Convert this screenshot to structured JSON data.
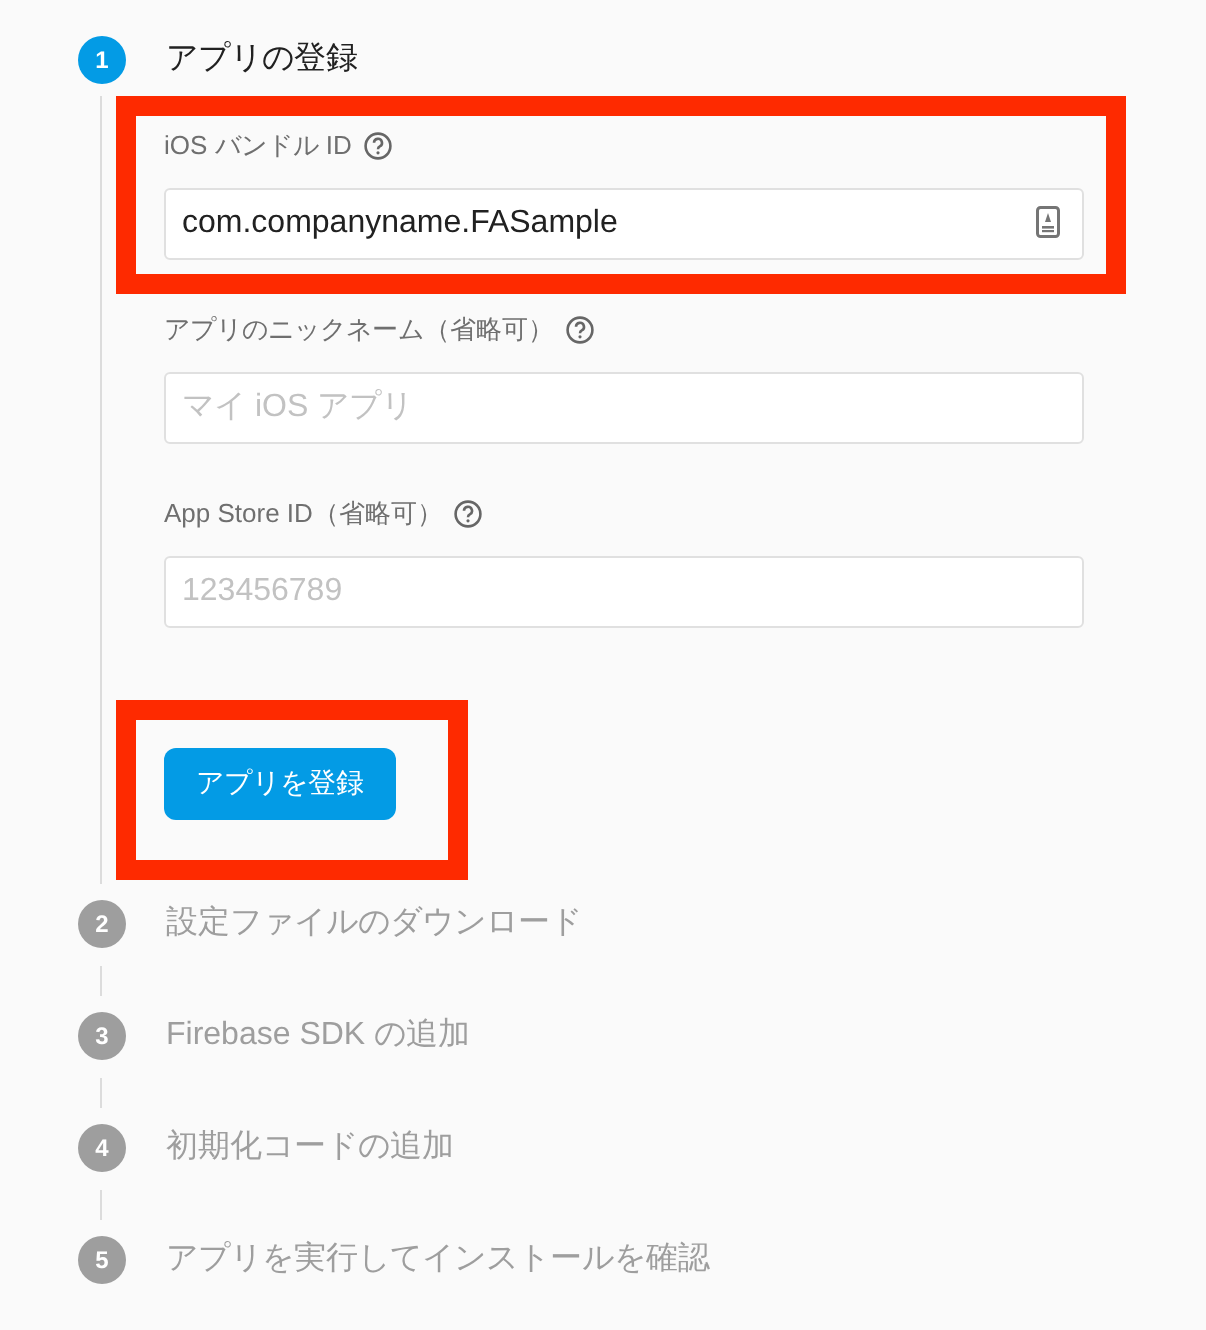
{
  "steps": [
    {
      "number": "1",
      "title": "アプリの登録",
      "active": true,
      "fields": [
        {
          "label": "iOS バンドル ID",
          "kind": "badge",
          "value": "com.companyname.FASample",
          "highlighted": true
        },
        {
          "label": "アプリのニックネーム（省略可）",
          "kind": "plain",
          "placeholder": "マイ iOS アプリ",
          "highlighted": false
        },
        {
          "label": "App Store ID（省略可）",
          "kind": "plain",
          "placeholder": "123456789",
          "highlighted": false
        }
      ],
      "button": {
        "label": "アプリを登録",
        "highlighted": true
      }
    },
    {
      "number": "2",
      "title": "設定ファイルのダウンロード",
      "active": false
    },
    {
      "number": "3",
      "title": "Firebase SDK の追加",
      "active": false
    },
    {
      "number": "4",
      "title": "初期化コードの追加",
      "active": false
    },
    {
      "number": "5",
      "title": "アプリを実行してインストールを確認",
      "active": false
    }
  ]
}
